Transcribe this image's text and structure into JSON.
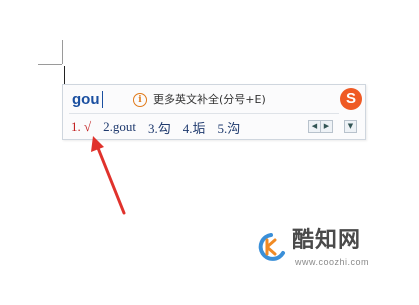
{
  "ime": {
    "composition": "gou",
    "hint": "更多英文补全(分号+E)",
    "candidates": [
      "1. √",
      "2.gout",
      "3.勾",
      "4.垢",
      "5.沟"
    ],
    "page_prev": "◀",
    "page_next": "▶",
    "menu": "▼"
  },
  "watermark": {
    "title": "酷知网",
    "url": "www.coozhi.com"
  },
  "colors": {
    "annotation_arrow": "#e0322c",
    "sogou_logo": "#ef5a24",
    "composition_text": "#1a4fa0",
    "first_candidate": "#c21f1f"
  },
  "icons": {
    "info": "info-icon",
    "sogou": "sogou-logo-icon",
    "watermark_logo": "coozhi-logo-icon"
  }
}
